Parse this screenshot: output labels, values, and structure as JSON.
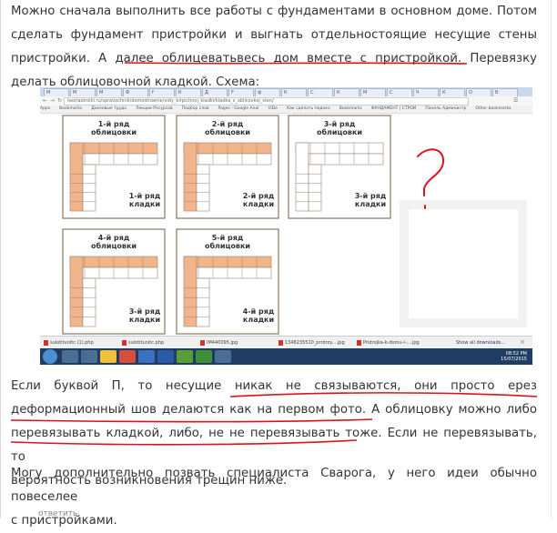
{
  "post": {
    "p1_l1": "Можно сначала выполнить все работы с фундаментами в основном доме. Потом",
    "p1_l2": "сделать фундамент пристройки и выгнать отдельностоящие несущие стены",
    "p1_l3a": "пристройки.",
    "p1_l3b": "А далее облицеватьвесь дом вместе с пристройкой.",
    "p1_l3c": "Перевязку",
    "p1_l4": "делать облицовочной кладкой. Схема:",
    "p2_l1": "Если буквой П, то несущие никак не связываются, они просто ерез",
    "p2_l2": "деформационный шов делаются как на первом фото. А облицовку можно либо",
    "p2_l3": "перевязывать кладкой, либо, не не перевязывать тоже. Если не перевязывать, то",
    "p2_l4": "вероятность возникновения трещин ниже.",
    "p3_l1": "Могу дополнительно позвать специалиста Сварога, у него идеи обычно повеселее",
    "p3_l2": "с пристройками.",
    "footer_link": "ответить"
  },
  "screenshot": {
    "url": "teoriastroiki.ru/spravochnik/domostroenie/vidy_kirpichnoj_kladki/kladka_s_oblicovkoj_sten/",
    "tabs": [
      "М",
      "М",
      "М",
      "Ф",
      "f",
      "К",
      "Д",
      "F",
      "ф",
      "К",
      "С",
      "К",
      "М",
      "С",
      "Ч",
      "К",
      "О",
      "В"
    ],
    "bookmarks": [
      "Apps",
      "Bookmarks",
      "Дисковые трудо",
      "Лекции Ресурсов",
      "Подбор слов",
      "Pages - Google Anal",
      "ViDe",
      "Как сделать подоко",
      "Bookmarks",
      "ФУНДАМЕНТ | СТРОИ",
      "Панель Администр",
      "Other bookmarks"
    ],
    "schemes": [
      {
        "oblic": "1-й ряд\nоблицовки",
        "kladki": "1-й ряд\nкладки"
      },
      {
        "oblic": "2-й ряд\nоблицовки",
        "kladki": "2-й ряд\nкладки"
      },
      {
        "oblic": "3-й ряд\nоблицовки",
        "kladki": "3-й ряд\nкладки"
      },
      {
        "oblic": "4-й ряд\nоблицовки",
        "kladki": "3-й ряд\nкладки"
      },
      {
        "oblic": "5-й ряд\nоблицовки",
        "kladki": "4-й ряд\nкладки"
      }
    ],
    "downloads": [
      "sulotitunitc (1).php",
      "sulotitunitc.php",
      "IM440095.jpg",
      "1348235510_prrdrzy....jpg",
      "Pridrojka-k-domu-i-....jpg"
    ],
    "show_all": "Show all downloads...",
    "clock_time": "08:52 PM",
    "clock_date": "15/07/2015",
    "annotation": "?"
  },
  "colors": {
    "brick": "#f2b48b",
    "mark": "#e0101b",
    "frame": "#8a7560"
  }
}
